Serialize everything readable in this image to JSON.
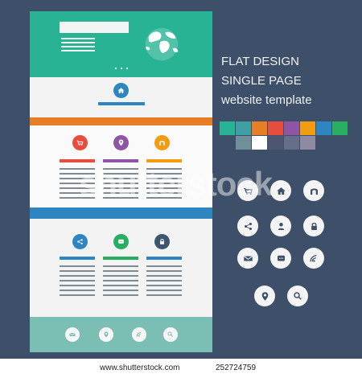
{
  "brand": {
    "title_lines": [
      "FLAT DESIGN",
      "SINGLE PAGE",
      "website template"
    ]
  },
  "colors": {
    "background": "#3d4f69",
    "teal": "#27b394",
    "orange": "#e77d25",
    "blue": "#2e86c1",
    "red": "#e74c3c",
    "purple": "#8e55a4",
    "yellow": "#f39c12",
    "green": "#27ae60",
    "footer": "#7abeb4"
  },
  "palette": [
    "#27b394",
    "#3ea0a5",
    "#e77d25",
    "#e74c3c",
    "#8e55a4",
    "#f39c12",
    "#2e86c1",
    "#27ae60",
    "#6f8f9a",
    "#ffffff",
    "#4d5570",
    "#666d88",
    "#8f8aa3"
  ],
  "icons": {
    "top_section": [
      "home-icon"
    ],
    "orange_section": [
      "shopping-cart-icon",
      "location-pin-icon",
      "tunnel-icon"
    ],
    "blue_section": [
      "share-icon",
      "chat-icon",
      "lock-icon"
    ],
    "footer": [
      "mail-icon",
      "location-pin-icon",
      "wifi-icon",
      "search-icon"
    ],
    "side_row1": [
      "shopping-cart-icon",
      "home-icon",
      "tunnel-icon"
    ],
    "side_row2": [
      "share-icon",
      "person-icon",
      "lock-icon"
    ],
    "side_row3": [
      "mail-icon",
      "chat-icon",
      "wifi-icon"
    ],
    "side_row4": [
      "location-pin-icon",
      "search-icon"
    ]
  },
  "watermark": "shutterstock",
  "caption": {
    "url": "www.shutterstock.com",
    "id": "252724759"
  }
}
